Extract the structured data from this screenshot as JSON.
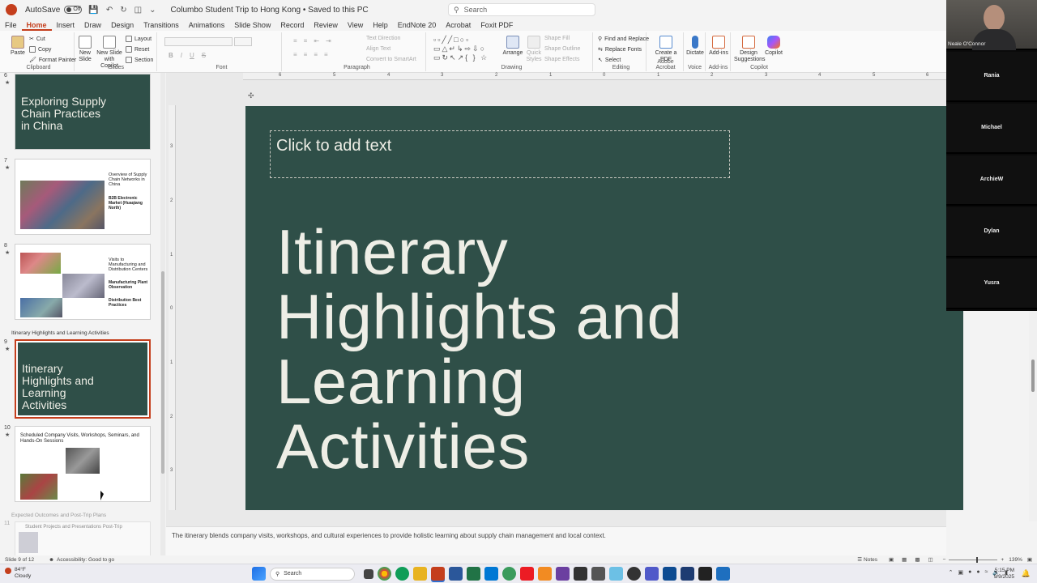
{
  "titlebar": {
    "autosave_label": "AutoSave",
    "autosave_state": "Off",
    "document_title": "Columbo Student Trip to Hong Kong • Saved to this PC",
    "search_placeholder": "Search"
  },
  "menu": {
    "tabs": [
      "File",
      "Home",
      "Insert",
      "Draw",
      "Design",
      "Transitions",
      "Animations",
      "Slide Show",
      "Record",
      "Review",
      "View",
      "Help",
      "EndNote 20",
      "Acrobat",
      "Foxit PDF"
    ],
    "active": "Home"
  },
  "ribbon": {
    "clipboard": {
      "label": "Clipboard",
      "paste": "Paste",
      "cut": "Cut",
      "copy": "Copy",
      "format_painter": "Format Painter"
    },
    "slides": {
      "label": "Slides",
      "new_slide": "New Slide",
      "new_slide_copilot": "New Slide with Copilot",
      "layout": "Layout",
      "reset": "Reset",
      "section": "Section"
    },
    "font": {
      "label": "Font",
      "bold": "B",
      "italic": "I",
      "underline": "U",
      "strike": "S"
    },
    "paragraph": {
      "label": "Paragraph",
      "text_direction": "Text Direction",
      "align_text": "Align Text",
      "convert_smartart": "Convert to SmartArt"
    },
    "drawing": {
      "label": "Drawing",
      "arrange": "Arrange",
      "quick_styles": "Quick Styles",
      "shape_fill": "Shape Fill",
      "shape_outline": "Shape Outline",
      "shape_effects": "Shape Effects"
    },
    "editing": {
      "label": "Editing",
      "find_replace": "Find and Replace",
      "replace_fonts": "Replace Fonts",
      "select": "Select"
    },
    "acrobat": {
      "label": "Adobe Acrobat",
      "create_pdf": "Create a PDF"
    },
    "voice": {
      "label": "Voice",
      "dictate": "Dictate"
    },
    "addins": {
      "label": "Add-ins",
      "addins": "Add-ins"
    },
    "copilot": {
      "label": "Copilot",
      "design_suggestions": "Design Suggestions",
      "copilot": "Copilot"
    }
  },
  "thumbnails": {
    "slide6": {
      "num": "6",
      "title": "Exploring Supply Chain Practices in China"
    },
    "slide7": {
      "num": "7",
      "heading": "Overview of Supply Chain Networks in China",
      "sub": "B2B Electronic Market (Huaqiang North)"
    },
    "slide8": {
      "num": "8",
      "heading": "Visits to Manufacturing and Distribution Centers",
      "sub1": "Manufacturing Plant Observation",
      "sub2": "Distribution Best Practices"
    },
    "section1": "Itinerary Highlights and Learning Activities",
    "slide9": {
      "num": "9",
      "title": "Itinerary Highlights and Learning Activities"
    },
    "slide10": {
      "num": "10",
      "heading": "Scheduled Company Visits, Workshops, Seminars, and Hands-On Sessions"
    },
    "section2": "Expected Outcomes and Post-Trip Plans",
    "slide11": {
      "num": "11",
      "heading": "Student Projects and Presentations Post-Trip"
    }
  },
  "slide": {
    "placeholder": "Click to add text",
    "title_line1": "Itinerary",
    "title_line2": "Highlights and",
    "title_line3": "Learning",
    "title_line4": "Activities"
  },
  "ruler": {
    "h": [
      "6",
      "5",
      "4",
      "3",
      "2",
      "1",
      "0",
      "1",
      "2",
      "3",
      "4",
      "5",
      "6"
    ],
    "v": [
      "3",
      "2",
      "1",
      "0",
      "1",
      "2",
      "3"
    ]
  },
  "notes": "The itinerary blends company visits, workshops, and cultural experiences to provide holistic learning about supply chain management and local context.",
  "status": {
    "slide_counter": "Slide 9 of 12",
    "accessibility": "Accessibility: Good to go",
    "notes_button": "Notes",
    "zoom": "139%"
  },
  "taskbar": {
    "temp": "84°F",
    "weather": "Cloudy",
    "search": "Search",
    "time": "5:15 PM",
    "date": "9/9/2025"
  },
  "gallery": {
    "presenter": "Neale O'Connor",
    "participants": [
      "Rania",
      "Michael",
      "ArchieW",
      "Dylan",
      "Yusra"
    ]
  },
  "colors": {
    "accent": "#c43e1c",
    "slide_bg": "#2f4f48",
    "slide_text": "#eeeee6"
  }
}
